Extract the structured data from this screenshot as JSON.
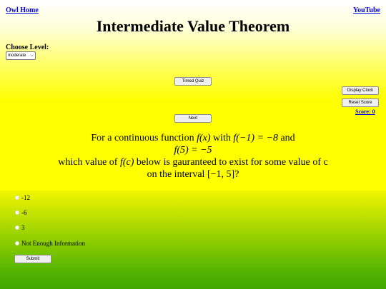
{
  "nav": {
    "home_link": "Owl Home",
    "youtube_link": "YouTube"
  },
  "page": {
    "title": "Intermediate Value Theorem"
  },
  "level": {
    "label": "Choose Level:",
    "selected": "moderate"
  },
  "buttons": {
    "timed_quiz": "Timed Quiz",
    "display_clock": "Display Clock",
    "reset_score": "Reset Score",
    "next": "Next",
    "submit": "Submit"
  },
  "score": {
    "label": "Score: 0"
  },
  "question": {
    "part1": "For a continuous function ",
    "f_x": "f(x)",
    "part2": " with ",
    "f_neg1": "f(−1) = −8",
    "part3": " and",
    "f_5": "f(5) = −5",
    "part4": "which value of ",
    "f_c": "f(c)",
    "part5": " below is gauranteed to exist for some value of c on the interval ",
    "interval": "[−1, 5]",
    "part6": "?"
  },
  "choices": [
    "-12",
    "-6",
    "3",
    "Not Enough Information"
  ],
  "colors": {
    "link": "#0000ee",
    "top_background": "#ffff00",
    "bottom_background": "#3fa700"
  }
}
